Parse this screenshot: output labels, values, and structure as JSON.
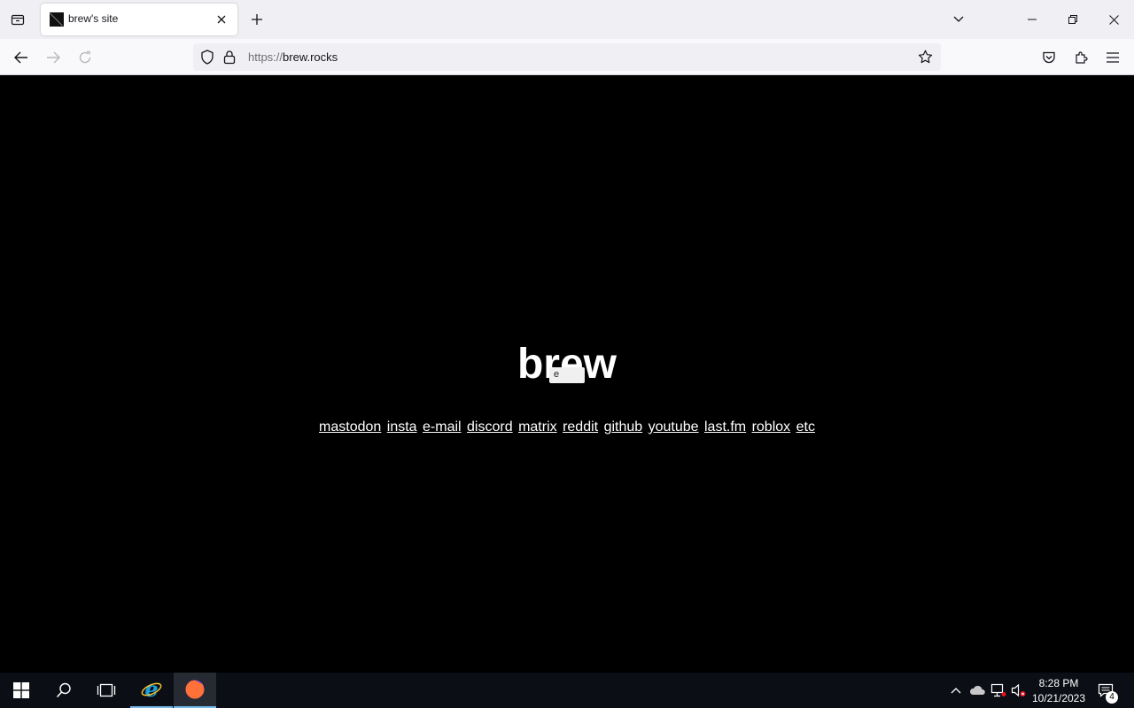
{
  "browser": {
    "tab": {
      "title": "brew's site"
    },
    "url": {
      "scheme": "https://",
      "host": "brew.rocks"
    }
  },
  "page": {
    "heading": "brew",
    "tooltip": "e",
    "links": [
      {
        "label": "mastodon"
      },
      {
        "label": "insta"
      },
      {
        "label": "e-mail"
      },
      {
        "label": "discord"
      },
      {
        "label": "matrix"
      },
      {
        "label": "reddit"
      },
      {
        "label": "github"
      },
      {
        "label": "youtube"
      },
      {
        "label": "last.fm"
      },
      {
        "label": "roblox"
      },
      {
        "label": "etc"
      }
    ]
  },
  "taskbar": {
    "time": "8:28 PM",
    "date": "10/21/2023",
    "notification_count": "4"
  },
  "colors": {
    "page_background": "#000000",
    "page_text": "#ffffff",
    "taskbar_accent": "#76b9ed"
  }
}
